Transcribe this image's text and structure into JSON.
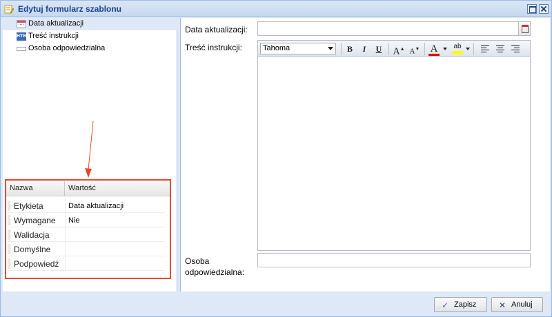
{
  "window": {
    "title": "Edytuj formularz szablonu"
  },
  "tree": {
    "items": [
      {
        "label": "Data aktualizacji",
        "icon": "calendar-field-icon",
        "selected": true
      },
      {
        "label": "Treść instrukcji",
        "icon": "html-field-icon",
        "selected": false
      },
      {
        "label": "Osoba odpowiedzialna",
        "icon": "text-field-icon",
        "selected": false
      }
    ]
  },
  "properties": {
    "headers": {
      "name": "Nazwa",
      "value": "Wartość"
    },
    "rows": [
      {
        "name": "Etykieta",
        "value": "Data aktualizacji"
      },
      {
        "name": "Wymagane",
        "value": "Nie"
      },
      {
        "name": "Walidacja",
        "value": ""
      },
      {
        "name": "Domyślne",
        "value": ""
      },
      {
        "name": "Podpowiedź",
        "value": ""
      }
    ]
  },
  "form": {
    "date_label": "Data aktualizacji:",
    "date_value": "",
    "instructions_label": "Treść instrukcji:",
    "responsible_label_line1": "Osoba",
    "responsible_label_line2": "odpowiedzialna:",
    "responsible_value": ""
  },
  "editor": {
    "font": "Tahoma",
    "bold": "B",
    "italic": "I",
    "underline": "U",
    "grow": "A",
    "shrink": "A",
    "fontcolor": "A",
    "highlight": "ab",
    "fontcolor_swatch": "#e00000",
    "highlight_swatch": "#ffff00"
  },
  "footer": {
    "save_label": "Zapisz",
    "cancel_label": "Anuluj"
  },
  "colors": {
    "annotation": "#e34a2d"
  }
}
